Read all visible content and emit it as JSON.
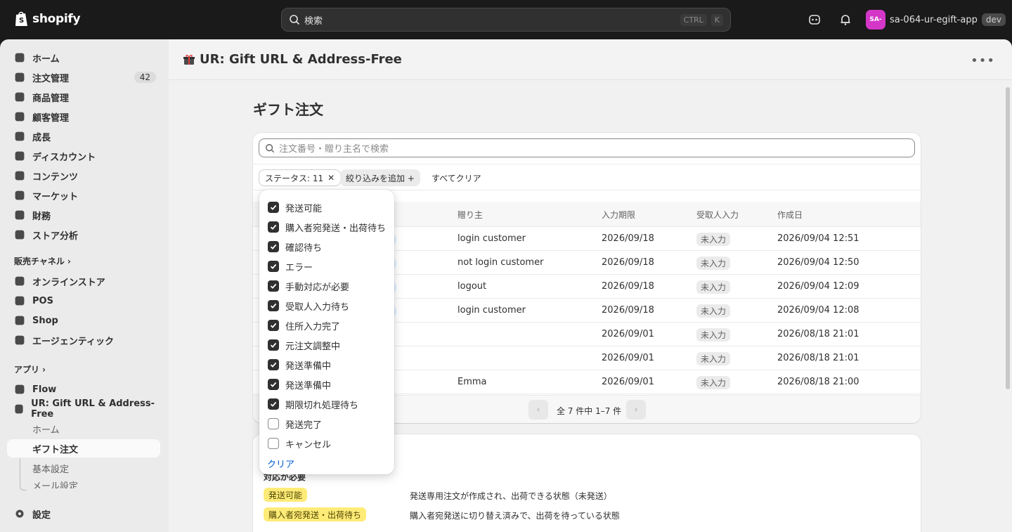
{
  "topbar": {
    "logo_text": "shopify",
    "search_placeholder": "検索",
    "shortcut_ctrl": "CTRL",
    "shortcut_k": "K",
    "store_initials": "SA-",
    "store_name": "sa-064-ur-egift-app",
    "env_badge": "dev"
  },
  "sidebar": {
    "items": [
      {
        "label": "ホーム",
        "icon": "home-icon"
      },
      {
        "label": "注文管理",
        "icon": "inbox-icon",
        "count": "42"
      },
      {
        "label": "商品管理",
        "icon": "tag-icon"
      },
      {
        "label": "顧客管理",
        "icon": "person-icon"
      },
      {
        "label": "成長",
        "icon": "growth-icon"
      },
      {
        "label": "ディスカウント",
        "icon": "discount-icon"
      },
      {
        "label": "コンテンツ",
        "icon": "content-icon"
      },
      {
        "label": "マーケット",
        "icon": "globe-icon"
      },
      {
        "label": "財務",
        "icon": "bank-icon"
      },
      {
        "label": "ストア分析",
        "icon": "chart-icon"
      }
    ],
    "channels_label": "販売チャネル",
    "channels": [
      {
        "label": "オンラインストア",
        "icon": "store-icon"
      },
      {
        "label": "POS",
        "icon": "pos-icon"
      },
      {
        "label": "Shop",
        "icon": "shop-icon"
      },
      {
        "label": "エージェンティック",
        "icon": "agent-icon"
      }
    ],
    "apps_label": "アプリ",
    "apps": [
      {
        "label": "Flow",
        "icon": "flow-icon"
      },
      {
        "label": "UR: Gift URL & Address-Free",
        "icon": "gift-icon"
      }
    ],
    "app_sub": [
      "ホーム",
      "ギフト注文",
      "基本設定",
      "メール設定"
    ],
    "settings_label": "設定"
  },
  "app_header": {
    "title": "UR: Gift URL & Address-Free",
    "more": "•••"
  },
  "page": {
    "title": "ギフト注文"
  },
  "orders": {
    "search_placeholder": "注文番号・贈り主名で検索",
    "filter_status": "ステータス: 11",
    "filter_add": "絞り込みを追加 +",
    "filter_clear_all": "すべてクリア",
    "columns": [
      "贈り主",
      "入力期限",
      "受取人入力",
      "作成日"
    ],
    "rows": [
      {
        "sender": "login customer",
        "deadline": "2026/09/18",
        "recipient": "未入力",
        "created": "2026/09/04 12:51"
      },
      {
        "sender": "not login customer",
        "deadline": "2026/09/18",
        "recipient": "未入力",
        "created": "2026/09/04 12:50"
      },
      {
        "sender": "logout",
        "deadline": "2026/09/18",
        "recipient": "未入力",
        "created": "2026/09/04 12:09"
      },
      {
        "sender": "login customer",
        "deadline": "2026/09/18",
        "recipient": "未入力",
        "created": "2026/09/04 12:08"
      },
      {
        "sender": "",
        "deadline": "2026/09/01",
        "recipient": "未入力",
        "created": "2026/08/18 21:01"
      },
      {
        "sender": "",
        "deadline": "2026/09/01",
        "recipient": "未入力",
        "created": "2026/08/18 21:01"
      },
      {
        "sender": "Emma",
        "deadline": "2026/09/01",
        "recipient": "未入力",
        "created": "2026/08/18 21:00"
      }
    ],
    "pagination": "全 7 件中 1–7 件"
  },
  "legend": {
    "section_label": "対応が必要",
    "items": [
      {
        "badge": "発送可能",
        "desc": "発送専用注文が作成され、出荷できる状態（未発送）"
      },
      {
        "badge": "購入者宛発送・出荷待ち",
        "desc": "購入者宛発送に切り替え済みで、出荷を待っている状態"
      }
    ]
  },
  "status_dropdown": {
    "options": [
      {
        "label": "発送可能",
        "checked": true
      },
      {
        "label": "購入者宛発送・出荷待ち",
        "checked": true
      },
      {
        "label": "確認待ち",
        "checked": true
      },
      {
        "label": "エラー",
        "checked": true
      },
      {
        "label": "手動対応が必要",
        "checked": true
      },
      {
        "label": "受取人入力待ち",
        "checked": true
      },
      {
        "label": "住所入力完了",
        "checked": true
      },
      {
        "label": "元注文調整中",
        "checked": true
      },
      {
        "label": "発送準備中",
        "checked": true
      },
      {
        "label": "発送準備中",
        "checked": true
      },
      {
        "label": "期限切れ処理待ち",
        "checked": true
      },
      {
        "label": "発送完了",
        "checked": false
      },
      {
        "label": "キャンセル",
        "checked": false
      }
    ],
    "clear_label": "クリア"
  },
  "colors": {
    "accent_link": "#005bd3",
    "attention_badge": "#ffeb78",
    "app_icon": "#d437c7"
  }
}
